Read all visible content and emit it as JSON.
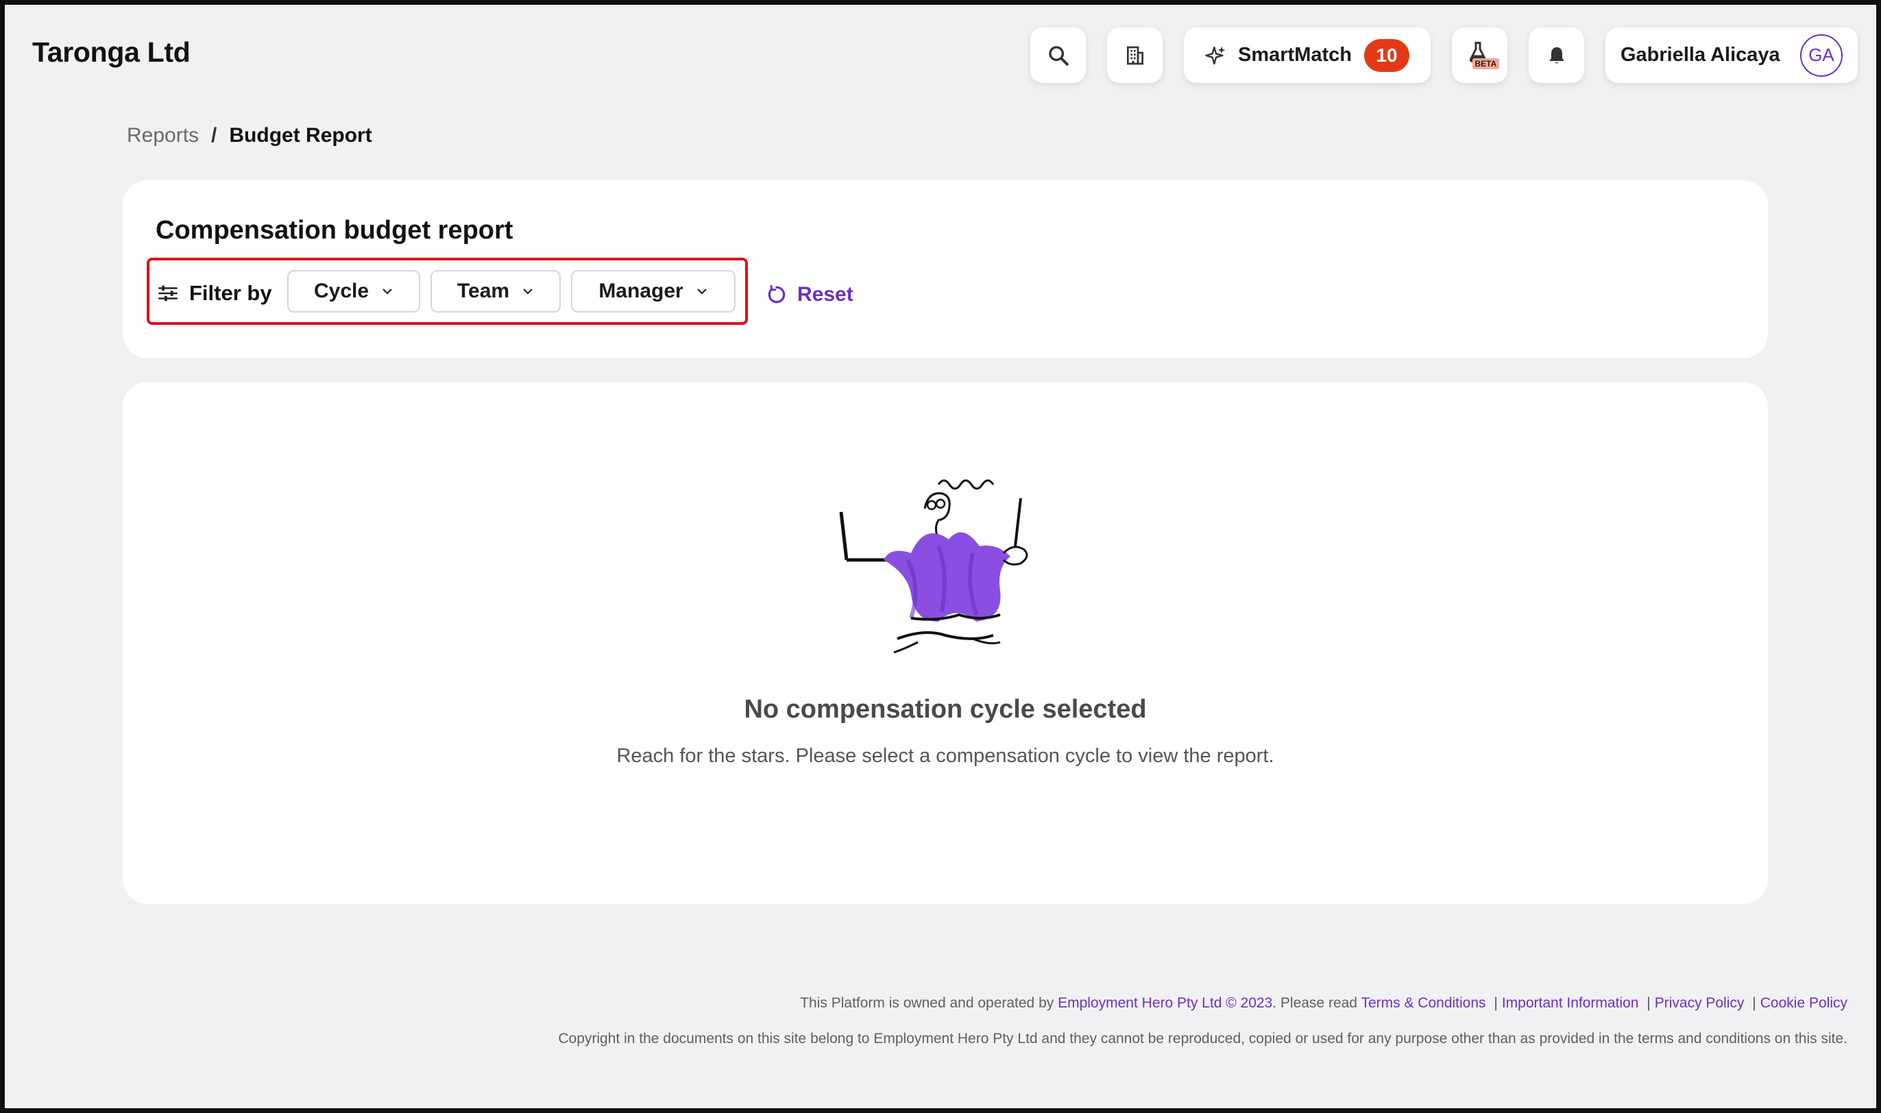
{
  "header": {
    "company": "Taronga Ltd",
    "smartmatch_label": "SmartMatch",
    "smartmatch_count": "10",
    "beta_label": "BETA",
    "user_name": "Gabriella Alicaya",
    "user_initials": "GA"
  },
  "breadcrumb": {
    "parent": "Reports",
    "separator": "/",
    "current": "Budget Report"
  },
  "filter_card": {
    "title": "Compensation budget report",
    "filter_label": "Filter by",
    "dropdowns": [
      {
        "label": "Cycle"
      },
      {
        "label": "Team"
      },
      {
        "label": "Manager"
      }
    ],
    "reset_label": "Reset"
  },
  "empty_state": {
    "title": "No compensation cycle selected",
    "description": "Reach for the stars. Please select a compensation cycle to view the report."
  },
  "footer": {
    "owned_prefix": "This Platform is owned and operated by",
    "owner_link": "Employment Hero Pty Ltd © 2023",
    "read_text": ". Please read",
    "links": [
      "Terms & Conditions",
      "Important Information",
      "Privacy Policy",
      "Cookie Policy"
    ],
    "separator": "|",
    "copyright": "Copyright in the documents on this site belong to Employment Hero Pty Ltd and they cannot be reproduced, copied or used for any purpose other than as provided in the terms and conditions on this site."
  },
  "colors": {
    "accent": "#6b2fc8",
    "badge": "#e23a17",
    "highlight": "#e10c1d",
    "page_bg": "#f1f1f3"
  }
}
